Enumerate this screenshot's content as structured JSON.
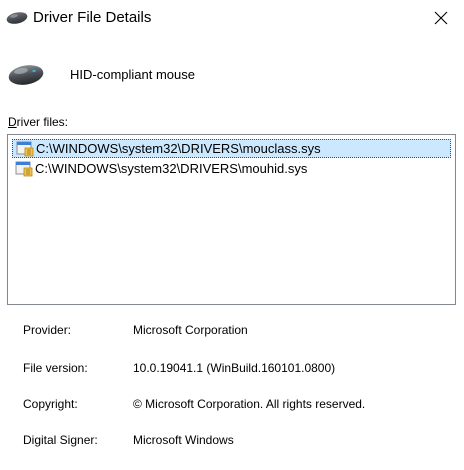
{
  "window": {
    "title": "Driver File Details",
    "close_icon": "close-icon",
    "title_icon": "mouse-icon"
  },
  "device": {
    "name": "HID-compliant mouse",
    "icon": "mouse-icon"
  },
  "files": {
    "label_accel": "D",
    "label_rest": "river files:",
    "items": [
      {
        "path": "C:\\WINDOWS\\system32\\DRIVERS\\mouclass.sys",
        "selected": true,
        "icon": "driver-file-icon"
      },
      {
        "path": "C:\\WINDOWS\\system32\\DRIVERS\\mouhid.sys",
        "selected": false,
        "icon": "driver-file-icon"
      }
    ]
  },
  "properties": [
    {
      "label": "Provider:",
      "value": "Microsoft Corporation"
    },
    {
      "label": "File version:",
      "value": "10.0.19041.1 (WinBuild.160101.0800)"
    },
    {
      "label": "Copyright:",
      "value": "© Microsoft Corporation. All rights reserved."
    },
    {
      "label": "Digital Signer:",
      "value": "Microsoft Windows"
    }
  ],
  "colors": {
    "selection": "#cce8ff",
    "list_border": "#828790"
  }
}
